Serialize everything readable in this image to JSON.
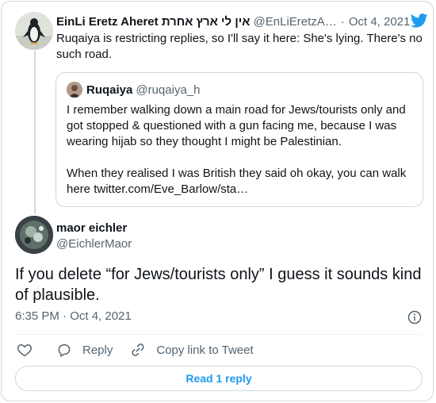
{
  "tweet": {
    "author_name": "EinLi Eretz Aheret אין לי ארץ אחרת",
    "author_handle": "@EnLiEretzA…",
    "separator": "·",
    "date": "Oct 4, 2021",
    "text": "Ruqaiya is restricting replies, so I'll say it here: She's lying. There's no such road.",
    "icons": {
      "brand": "twitter-bird-icon",
      "avatar": "penguin-avatar"
    }
  },
  "quoted": {
    "author_name": "Ruqaiya",
    "author_handle": "@ruqaiya_h",
    "paragraph1": "I remember walking down a main road for Jews/tourists only and got stopped & questioned with a gun facing me, because I was wearing hijab so they thought I might be Palestinian.",
    "paragraph2": "When they realised I was British they said oh okay, you can walk here twitter.com/Eve_Barlow/sta…"
  },
  "reply": {
    "author_name": "maor eichler",
    "author_handle": "@EichlerMaor",
    "text": "If you delete “for Jews/tourists only” I guess it sounds kind of plausible.",
    "timestamp": "6:35 PM · Oct 4, 2021"
  },
  "actions": {
    "reply_label": "Reply",
    "copy_label": "Copy link to Tweet",
    "read_replies_label": "Read 1 reply"
  },
  "colors": {
    "accent": "#1d9bf0",
    "muted": "#536471",
    "border": "#cfd9de"
  }
}
